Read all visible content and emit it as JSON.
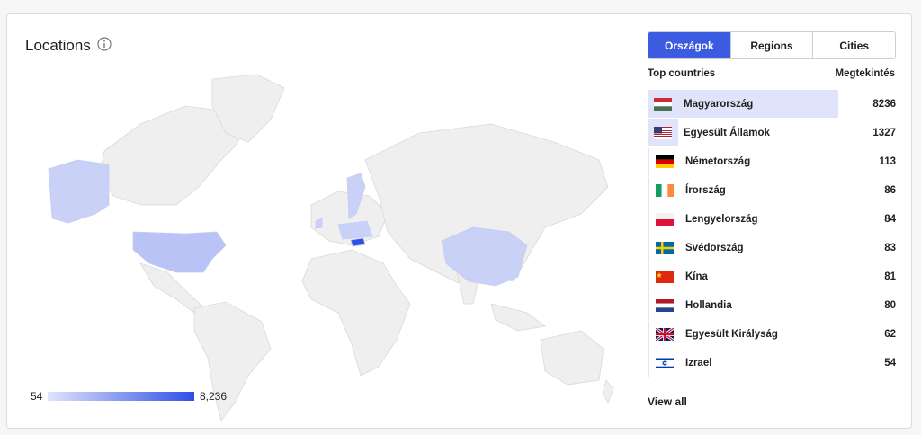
{
  "title": "Locations",
  "legend": {
    "min": "54",
    "max": "8,236"
  },
  "tabs": [
    "Országok",
    "Regions",
    "Cities"
  ],
  "header": {
    "left": "Top countries",
    "right": "Megtekintés"
  },
  "countries": [
    {
      "name": "Magyarország",
      "value": "8236",
      "flag": "hu-flag-icon"
    },
    {
      "name": "Egyesült Államok",
      "value": "1327",
      "flag": "us-flag-icon"
    },
    {
      "name": "Németország",
      "value": "113",
      "flag": "de-flag-icon"
    },
    {
      "name": "Írország",
      "value": "86",
      "flag": "ie-flag-icon"
    },
    {
      "name": "Lengyelország",
      "value": "84",
      "flag": "pl-flag-icon"
    },
    {
      "name": "Svédország",
      "value": "83",
      "flag": "se-flag-icon"
    },
    {
      "name": "Kína",
      "value": "81",
      "flag": "cn-flag-icon"
    },
    {
      "name": "Hollandia",
      "value": "80",
      "flag": "nl-flag-icon"
    },
    {
      "name": "Egyesült Királyság",
      "value": "62",
      "flag": "gb-flag-icon"
    },
    {
      "name": "Izrael",
      "value": "54",
      "flag": "il-flag-icon"
    }
  ],
  "highlight_share": [
    1.0,
    0.161
  ],
  "view_all": "View all",
  "colors": {
    "accent": "#3b5be0",
    "map_base": "#efefef",
    "map_low": "#c9d1f7",
    "map_high": "#2f4fe6"
  }
}
